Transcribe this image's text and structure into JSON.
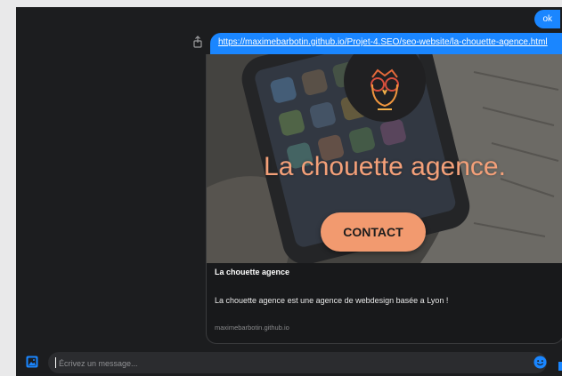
{
  "messages": {
    "ok_text": "ok",
    "link_url": "https://maximebarbotin.github.io/Projet-4.SEO/seo-website/la-chouette-agence.html"
  },
  "preview": {
    "hero_title": "La chouette agence.",
    "button_label": "CONTACT",
    "title": "La chouette agence",
    "description": "La chouette agence est une agence de webdesign basée a Lyon !",
    "domain": "maximebarbotin.github.io"
  },
  "composer": {
    "placeholder": "Écrivez un message..."
  },
  "icons": {
    "share": "share-icon",
    "image": "image-icon",
    "emoji": "emoji-icon",
    "logo": "owl-logo"
  },
  "colors": {
    "accent": "#1a86ff",
    "chat_bg": "#1c1d1f",
    "hero_text": "#f4a079",
    "button_bg": "#f29a6f"
  }
}
